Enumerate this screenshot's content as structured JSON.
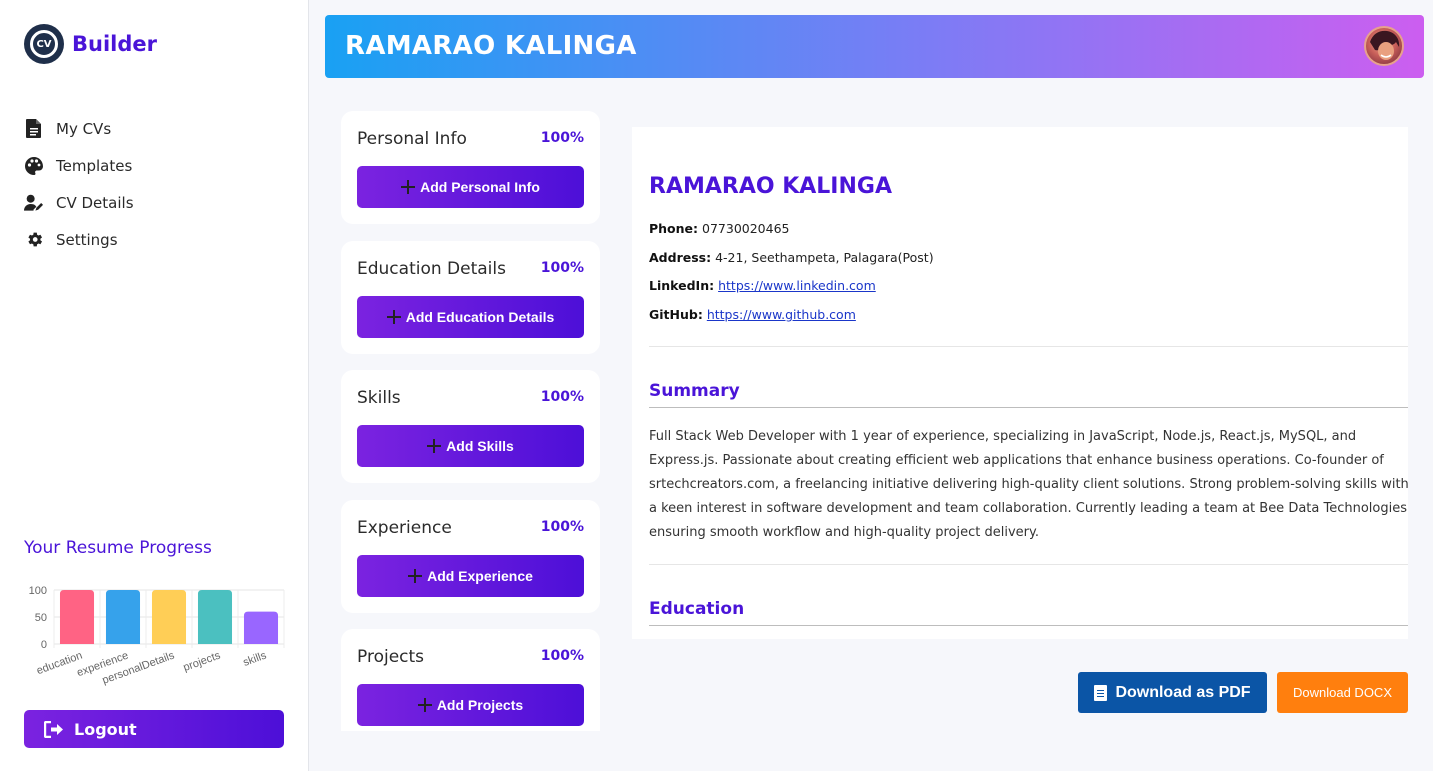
{
  "app": {
    "logo_text": "CV",
    "brand": "Builder"
  },
  "sidebar": {
    "nav": [
      {
        "label": "My CVs",
        "icon": "file-icon"
      },
      {
        "label": "Templates",
        "icon": "palette-icon"
      },
      {
        "label": "CV Details",
        "icon": "user-edit-icon"
      },
      {
        "label": "Settings",
        "icon": "gear-icon"
      }
    ],
    "progress_title": "Your Resume Progress",
    "logout_label": "Logout"
  },
  "chart_data": {
    "type": "bar",
    "categories": [
      "education",
      "experience",
      "personalDetails",
      "projects",
      "skills"
    ],
    "values": [
      100,
      100,
      100,
      100,
      60
    ],
    "colors": [
      "#ff6384",
      "#36a2eb",
      "#ffce56",
      "#4bc0c0",
      "#9966ff"
    ],
    "ylim": [
      0,
      100
    ],
    "yticks": [
      0,
      50,
      100
    ],
    "grid": true
  },
  "header": {
    "title": "RAMARAO KALINGA"
  },
  "sections": [
    {
      "title": "Personal Info",
      "percent": "100%",
      "button": "Add Personal Info"
    },
    {
      "title": "Education Details",
      "percent": "100%",
      "button": "Add Education Details"
    },
    {
      "title": "Skills",
      "percent": "100%",
      "button": "Add Skills"
    },
    {
      "title": "Experience",
      "percent": "100%",
      "button": "Add Experience"
    },
    {
      "title": "Projects",
      "percent": "100%",
      "button": "Add Projects"
    }
  ],
  "cv": {
    "name": "RAMARAO KALINGA",
    "phone_label": "Phone:",
    "phone": "07730020465",
    "address_label": "Address:",
    "address": "4-21, Seethampeta, Palagara(Post)",
    "linkedin_label": "LinkedIn:",
    "linkedin": "https://www.linkedin.com",
    "github_label": "GitHub:",
    "github": "https://www.github.com",
    "summary_heading": "Summary",
    "summary": "Full Stack Web Developer with 1 year of experience, specializing in JavaScript, Node.js, React.js, MySQL, and Express.js. Passionate about creating efficient web applications that enhance business operations. Co-founder of srtechcreators.com, a freelancing initiative delivering high-quality client solutions. Strong problem-solving skills with a keen interest in software development and team collaboration. Currently leading a team at Bee Data Technologies, ensuring smooth workflow and high-quality project delivery.",
    "education_heading": "Education"
  },
  "downloads": {
    "pdf_label": "Download as PDF",
    "docx_label": "Download DOCX"
  },
  "colors": {
    "accent": "#4a14d8",
    "button_gradient_start": "#7b23e0",
    "button_gradient_end": "#4d0fd8",
    "pdf": "#0b55a6",
    "docx": "#ff7f0e"
  }
}
